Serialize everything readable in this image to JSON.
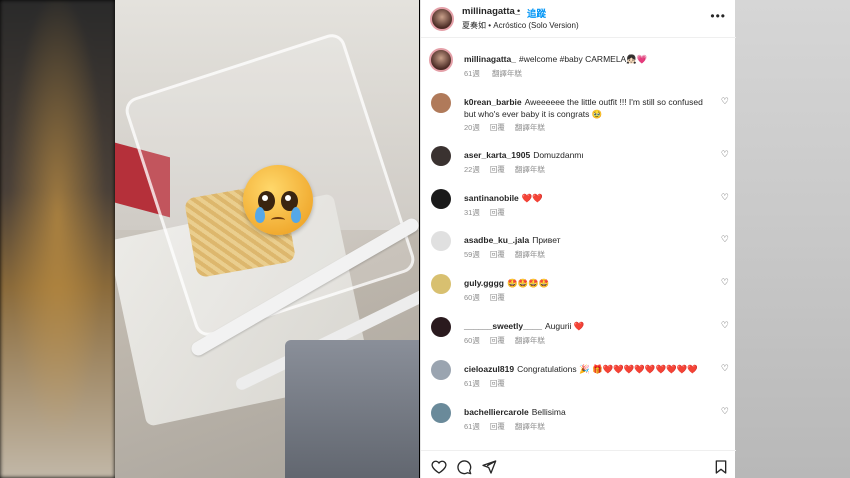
{
  "post": {
    "username": "millinagatta_",
    "separator": "•",
    "follow_label": "追蹤",
    "song": "夏奏如 • Acróstico (Solo Version)",
    "more_label": "•••"
  },
  "caption": {
    "username": "millinagatta_",
    "text": "#welcome #baby CARMELA👧🏻💗",
    "time": "61週",
    "translate": "翻譯年糕"
  },
  "comments": [
    {
      "username": "k0rean_barbie",
      "text": "Aweeeeee the little outfit !!! I'm still so confused but who's ever baby it is congrats 🥹",
      "time": "20週",
      "reply": "回覆",
      "translate": "翻譯年糕",
      "avatar_color": "#b07a5a"
    },
    {
      "username": "aser_karta_1905",
      "text": "Domuzdanmı",
      "time": "22週",
      "reply": "回覆",
      "translate": "翻譯年糕",
      "avatar_color": "#3a3230"
    },
    {
      "username": "santinanobile",
      "text": "❤️❤️",
      "time": "31週",
      "reply": "回覆",
      "translate": "",
      "avatar_color": "#1a1a1a"
    },
    {
      "username": "asadbe_ku_.jala",
      "text": "Привет",
      "time": "59週",
      "reply": "回覆",
      "translate": "翻譯年糕",
      "avatar_color": "#e0e0e0"
    },
    {
      "username": "guly.gggg",
      "text": "🤩🤩🤩🤩",
      "time": "60週",
      "reply": "回覆",
      "translate": "",
      "avatar_color": "#d8c070"
    },
    {
      "username": "______sweetly____",
      "text": "Augurii ❤️",
      "time": "60週",
      "reply": "回覆",
      "translate": "翻譯年糕",
      "avatar_color": "#2a1a1e"
    },
    {
      "username": "cieloazul819",
      "text": "Congratulations 🎉 🎁❤️❤️❤️❤️❤️❤️❤️❤️❤️",
      "time": "61週",
      "reply": "回覆",
      "translate": "",
      "avatar_color": "#9aa4b0"
    },
    {
      "username": "bachelliercarole",
      "text": "Bellisima",
      "time": "61週",
      "reply": "回覆",
      "translate": "翻譯年糕",
      "avatar_color": "#6a8a9a"
    }
  ],
  "icons": {
    "like": "heart-outline-icon",
    "comment": "comment-icon",
    "share": "send-icon",
    "save": "bookmark-icon"
  }
}
